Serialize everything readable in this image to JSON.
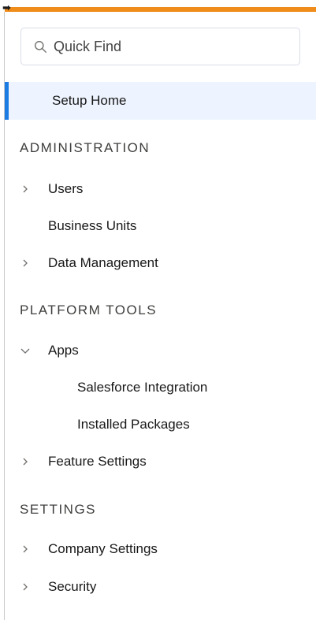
{
  "search": {
    "placeholder": "Quick Find"
  },
  "nav": {
    "setup_home": "Setup Home",
    "sections": [
      {
        "title": "ADMINISTRATION"
      },
      {
        "title": "PLATFORM TOOLS"
      },
      {
        "title": "SETTINGS"
      }
    ],
    "items": {
      "users": "Users",
      "business_units": "Business Units",
      "data_management": "Data Management",
      "apps": "Apps",
      "salesforce_integration": "Salesforce Integration",
      "installed_packages": "Installed Packages",
      "feature_settings": "Feature Settings",
      "company_settings": "Company Settings",
      "security": "Security"
    }
  },
  "colors": {
    "accent_bar": "#f08c1a",
    "active_indicator": "#1b7ce4",
    "active_background": "#eef4ff"
  },
  "icons": {
    "collapsed": "chevron-right-icon",
    "expanded": "chevron-down-icon",
    "search": "search-icon",
    "corner": "arrow-right-icon"
  }
}
